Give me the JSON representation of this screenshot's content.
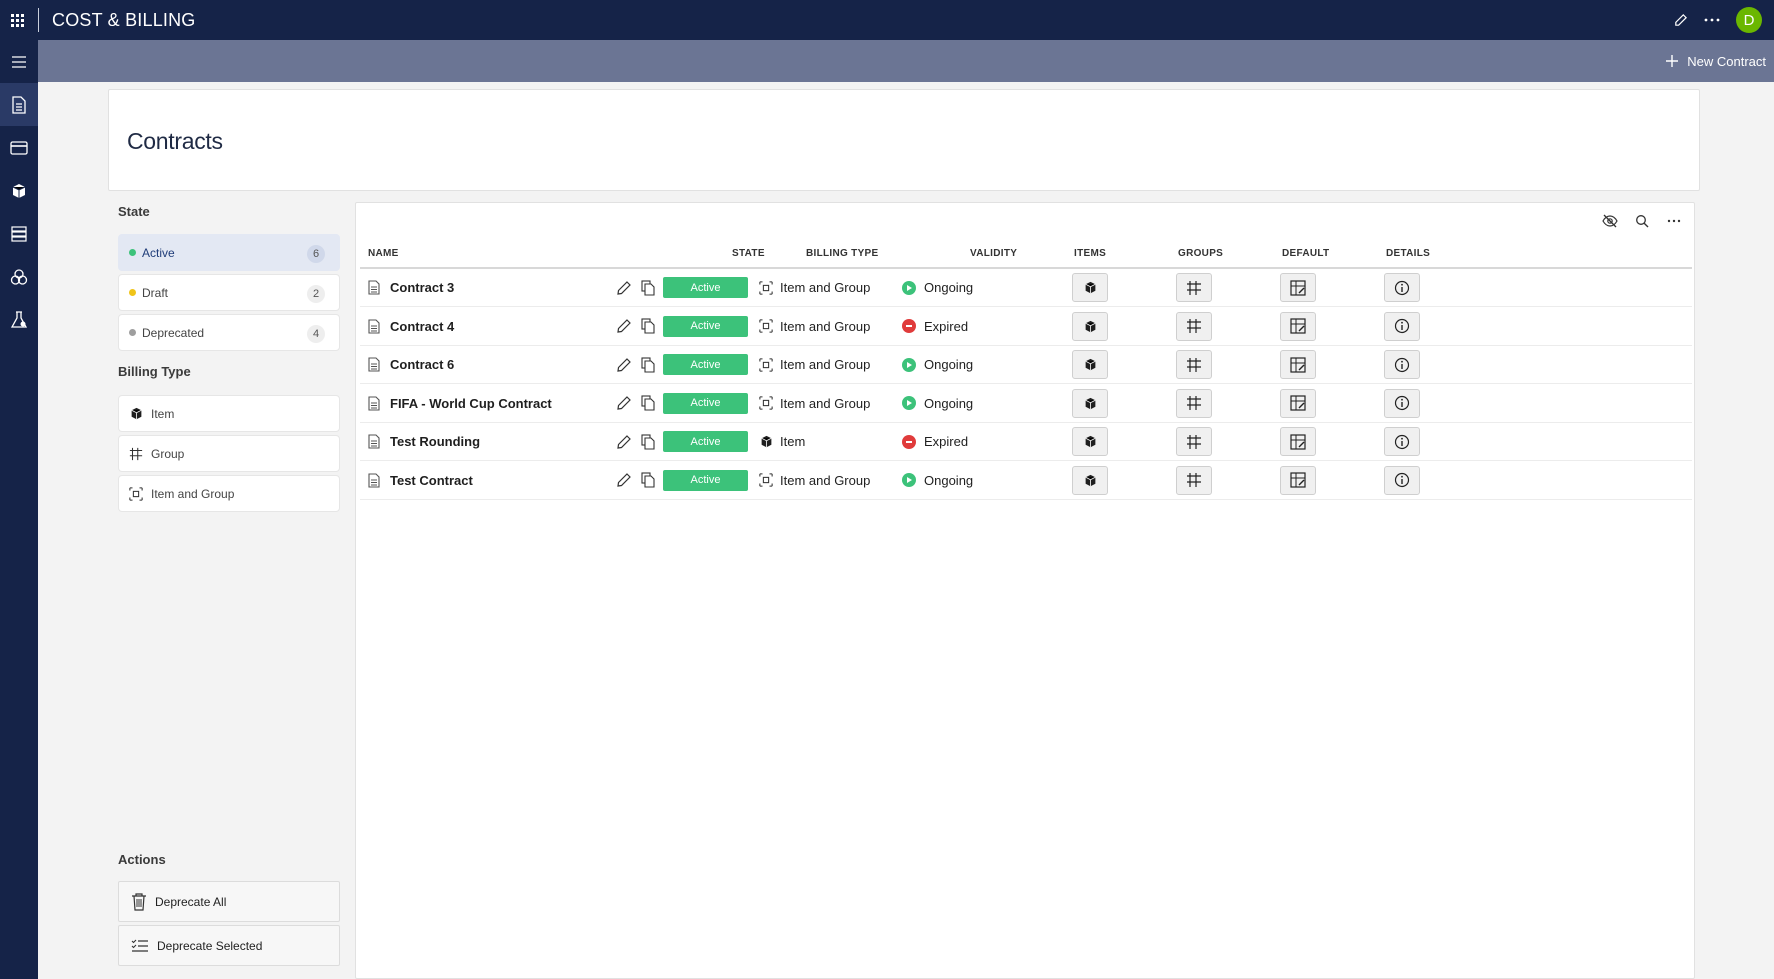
{
  "app": {
    "title": "COST & BILLING",
    "avatar_initial": "D",
    "avatar_color": "#6bb700"
  },
  "commandbar": {
    "new_contract_label": "New Contract"
  },
  "page": {
    "title": "Contracts"
  },
  "filters": {
    "state_title": "State",
    "states": [
      {
        "label": "Active",
        "count": "6",
        "color": "#3cc27a",
        "selected": true
      },
      {
        "label": "Draft",
        "count": "2",
        "color": "#f0c419",
        "selected": false
      },
      {
        "label": "Deprecated",
        "count": "4",
        "color": "#9e9e9e",
        "selected": false
      }
    ],
    "billing_title": "Billing Type",
    "billing_types": [
      {
        "label": "Item",
        "icon": "cube-icon"
      },
      {
        "label": "Group",
        "icon": "group-icon"
      },
      {
        "label": "Item and Group",
        "icon": "item-group-icon"
      }
    ],
    "actions_title": "Actions",
    "actions": [
      {
        "label": "Deprecate All",
        "icon": "trash-icon"
      },
      {
        "label": "Deprecate Selected",
        "icon": "checklist-icon"
      }
    ]
  },
  "grid": {
    "columns": [
      "NAME",
      "STATE",
      "BILLING TYPE",
      "VALIDITY",
      "ITEMS",
      "GROUPS",
      "DEFAULT",
      "DETAILS"
    ],
    "rows": [
      {
        "name": "Contract 3",
        "state": "Active",
        "billing": "Item and Group",
        "billing_icon": "item-group-icon",
        "validity": "Ongoing",
        "validity_color": "#3cc27a"
      },
      {
        "name": "Contract 4",
        "state": "Active",
        "billing": "Item and Group",
        "billing_icon": "item-group-icon",
        "validity": "Expired",
        "validity_color": "#e03b3b"
      },
      {
        "name": "Contract 6",
        "state": "Active",
        "billing": "Item and Group",
        "billing_icon": "item-group-icon",
        "validity": "Ongoing",
        "validity_color": "#3cc27a"
      },
      {
        "name": "FIFA - World Cup Contract",
        "state": "Active",
        "billing": "Item and Group",
        "billing_icon": "item-group-icon",
        "validity": "Ongoing",
        "validity_color": "#3cc27a"
      },
      {
        "name": "Test Rounding",
        "state": "Active",
        "billing": "Item",
        "billing_icon": "cube-icon",
        "validity": "Expired",
        "validity_color": "#e03b3b"
      },
      {
        "name": "Test Contract",
        "state": "Active",
        "billing": "Item and Group",
        "billing_icon": "item-group-icon",
        "validity": "Ongoing",
        "validity_color": "#3cc27a"
      }
    ]
  },
  "colors": {
    "topbar": "#152348",
    "commandbar": "#6b7594",
    "active_pill": "#3cc27a"
  }
}
